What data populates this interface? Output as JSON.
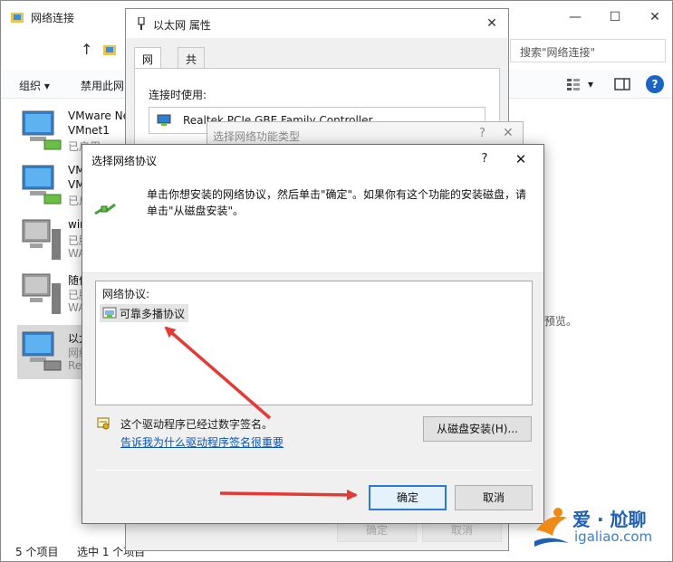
{
  "explorer": {
    "title": "网络连接",
    "controls": {
      "minimize": "—",
      "maximize": "☐",
      "close": "✕"
    },
    "nav_up": "↑",
    "search_placeholder": "搜索\"网络连接\"",
    "toolbar": {
      "organize": "组织 ▾",
      "disable": "禁用此网",
      "view_dropdown": "▾",
      "help": "?"
    },
    "items": [
      {
        "line1": "VMware Ne",
        "line2": "VMnet1",
        "line3": "已启用"
      },
      {
        "line1": "VM",
        "line2": "VM",
        "line3": "已启"
      },
      {
        "line1": "win",
        "line2": "已膨",
        "line3": "WA"
      },
      {
        "line1": "随便",
        "line2": "已膨",
        "line3": "WA"
      },
      {
        "line1": "以太",
        "line2": "网络",
        "line3": "Real"
      }
    ],
    "preview_text": "预览。",
    "status": {
      "count": "5 个项目",
      "selected": "选中 1 个项目"
    }
  },
  "props_dialog": {
    "title": "以太网 属性",
    "close": "✕",
    "tabs": [
      {
        "label": "网络"
      },
      {
        "label": "共享"
      }
    ],
    "connect_using_label": "连接时使用:",
    "adapter": "Realtek PCIe GBE Family Controller",
    "ok_ghost": "确定",
    "cancel_ghost": "取消"
  },
  "feature_dialog": {
    "title": "选择网络功能类型",
    "help": "?",
    "close": "✕"
  },
  "protocol_dialog": {
    "title": "选择网络协议",
    "help": "?",
    "close": "✕",
    "description": "单击你想安装的网络协议，然后单击\"确定\"。如果你有这个功能的安装磁盘，请单击\"从磁盘安装\"。",
    "list_label": "网络协议:",
    "protocols": [
      {
        "label": "可靠多播协议"
      }
    ],
    "signed_text": "这个驱动程序已经过数字签名。",
    "signed_link": "告诉我为什么驱动程序签名很重要",
    "have_disk_button": "从磁盘安装(H)...",
    "ok_button": "确定",
    "cancel_button": "取消"
  },
  "watermark": {
    "brand": "爱 · 尬聊",
    "url": "igaliao.com"
  },
  "colors": {
    "accent_blue": "#2a7ad6",
    "link_blue": "#0a55b5",
    "arrow_red": "#e53935",
    "dialog_bg": "#f0f0f0"
  }
}
